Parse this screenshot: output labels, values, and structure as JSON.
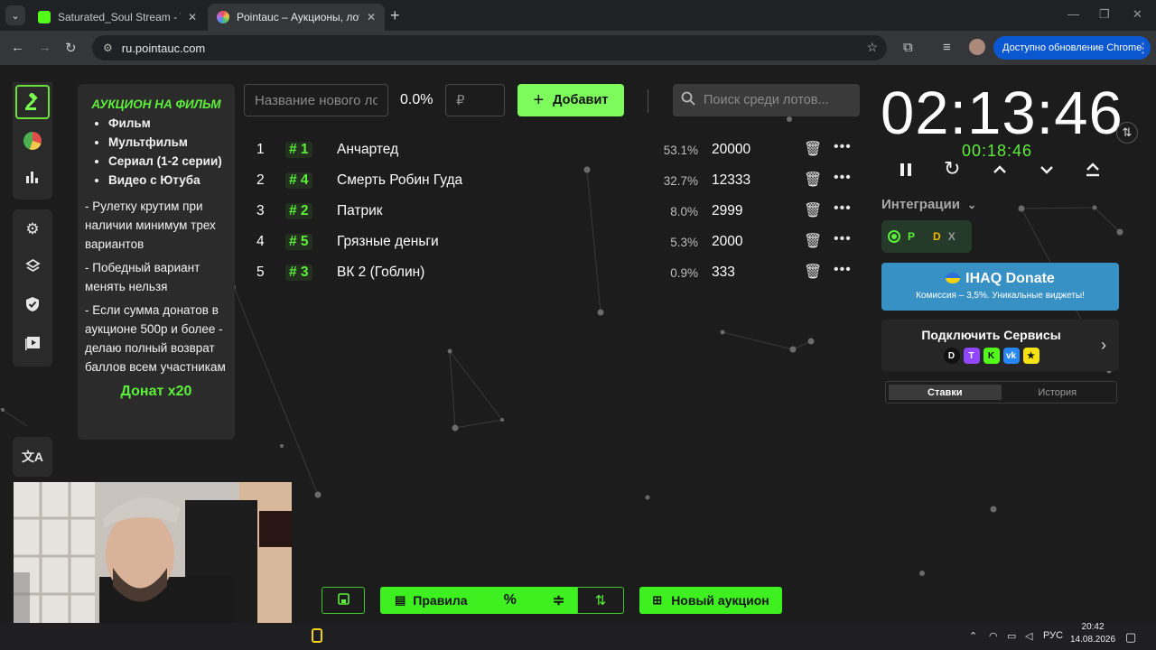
{
  "browser": {
    "tabs": [
      {
        "title": "Saturated_Soul Stream - Watch",
        "active": false,
        "favicon_color": "#53fc18"
      },
      {
        "title": "Pointauc – Аукционы, лотереи",
        "active": true,
        "favicon_color": "#c06ad8"
      }
    ],
    "url": "ru.pointauc.com",
    "update_label": "Доступно обновление Chrome"
  },
  "sidebar": {
    "top_icons": [
      "gavel-icon",
      "pie-chart-icon",
      "bar-chart-icon"
    ],
    "mid_icons": [
      "settings-icon",
      "layers-icon",
      "shield-icon",
      "video-icon"
    ],
    "bottom_icons": [
      "translate-icon"
    ]
  },
  "rules": {
    "title": "АУКЦИОН НА ФИЛЬМ",
    "categories": [
      "Фильм",
      "Мультфильм",
      "Сериал (1-2 серии)",
      "Видео с Ютуба"
    ],
    "notes": [
      "- Рулетку крутим при наличии минимум трех вариантов",
      "- Победный вариант менять нельзя",
      "-  Если сумма донатов в аукционе 500р и более - делаю полный возврат баллов всем участникам"
    ],
    "footer": "Донат x20"
  },
  "add_lot": {
    "name_placeholder": "Название нового лота",
    "percent": "0.0%",
    "amount_placeholder": "₽",
    "add_label": "Добавит",
    "search_placeholder": "Поиск среди лотов..."
  },
  "lots": [
    {
      "num": "1",
      "id": "# 1",
      "name": "Анчартед",
      "percent": "53.1%",
      "amount": "20000"
    },
    {
      "num": "2",
      "id": "# 4",
      "name": "Смерть Робин Гуда",
      "percent": "32.7%",
      "amount": "12333"
    },
    {
      "num": "3",
      "id": "# 2",
      "name": "Патрик",
      "percent": "8.0%",
      "amount": "2999"
    },
    {
      "num": "4",
      "id": "# 5",
      "name": "Грязные деньги",
      "percent": "5.3%",
      "amount": "2000"
    },
    {
      "num": "5",
      "id": "# 3",
      "name": "ВК 2 (Гоблин)",
      "percent": "0.9%",
      "amount": "333"
    }
  ],
  "timer": {
    "main": "02:13:46",
    "secondary": "00:18:46"
  },
  "integrations": {
    "label": "Интеграции",
    "icons": [
      "P",
      "D",
      "X"
    ]
  },
  "ihaq": {
    "title": "IHAQ Donate",
    "subtitle": "Комиссия – 3,5%. Уникальные виджеты!"
  },
  "connect": {
    "title": "Подключить Сервисы",
    "services": [
      {
        "label": "D",
        "color": "#1a1a1a"
      },
      {
        "label": "T",
        "color": "#9146ff"
      },
      {
        "label": "K",
        "color": "#53fc18"
      },
      {
        "label": "vk",
        "color": "#2787f5"
      },
      {
        "label": "★",
        "color": "#f5e211"
      }
    ]
  },
  "tabs_bottom": [
    "Ставки",
    "История"
  ],
  "bottom_buttons": {
    "rules_label": "Правила",
    "new_auction_label": "Новый аукцион"
  },
  "taskbar": {
    "lang": "РУС",
    "time": "20:42",
    "date": "14.08.2026"
  }
}
